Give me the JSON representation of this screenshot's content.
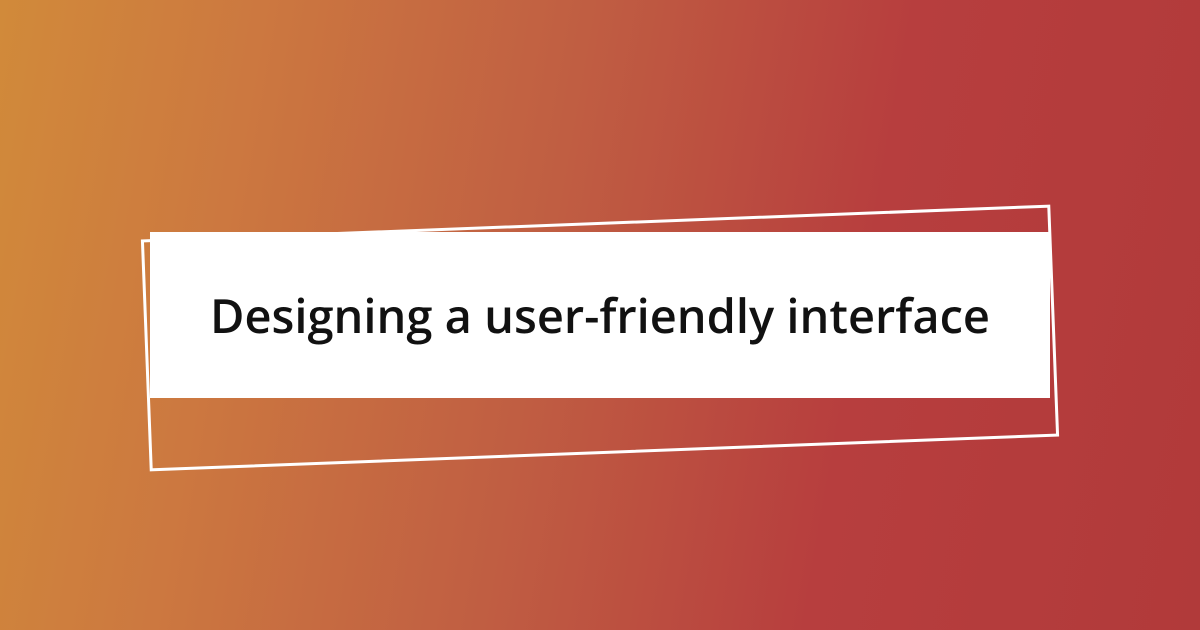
{
  "title": "Designing a user-friendly interface"
}
